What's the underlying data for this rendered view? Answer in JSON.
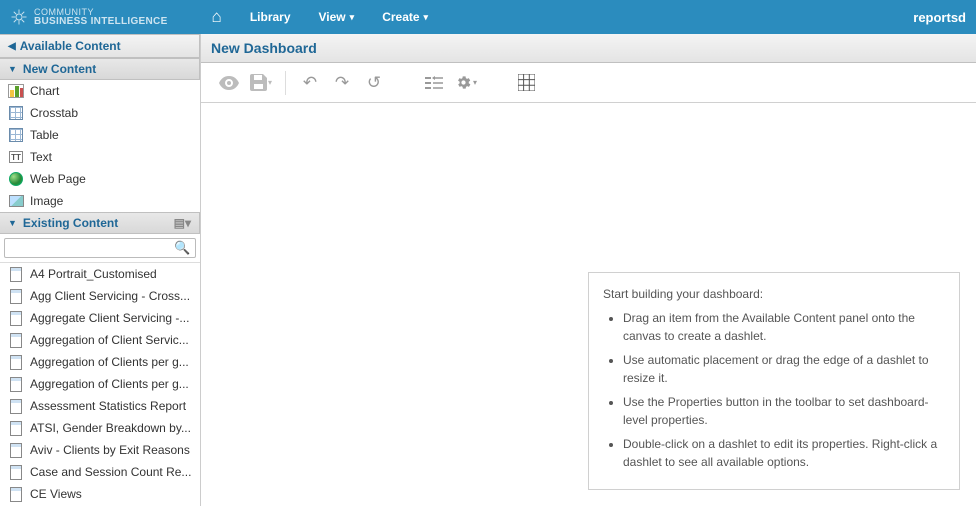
{
  "brand": {
    "line1": "COMMUNITY",
    "line2": "BUSINESS INTELLIGENCE"
  },
  "nav": {
    "home": "",
    "library": "Library",
    "view": "View",
    "create": "Create"
  },
  "user": "reportsd",
  "sidebar": {
    "title": "Available Content",
    "new": {
      "header": "New Content",
      "items": [
        "Chart",
        "Crosstab",
        "Table",
        "Text",
        "Web Page",
        "Image"
      ]
    },
    "existing": {
      "header": "Existing Content",
      "items": [
        "A4 Portrait_Customised",
        "Agg Client Servicing - Cross...",
        "Aggregate Client Servicing -...",
        "Aggregation of Client Servic...",
        "Aggregation of Clients per g...",
        "Aggregation of Clients per g...",
        "Assessment Statistics Report",
        "ATSI, Gender Breakdown by...",
        "Aviv - Clients by Exit Reasons",
        "Case and Session Count Re...",
        "CE Views"
      ]
    }
  },
  "content": {
    "title": "New Dashboard"
  },
  "help": {
    "intro": "Start building your dashboard:",
    "bullets": [
      "Drag an item from the Available Content panel onto the canvas to create a dashlet.",
      "Use automatic placement or drag the edge of a dashlet to resize it.",
      "Use the Properties button in the toolbar to set dashboard-level properties.",
      "Double-click on a dashlet to edit its properties. Right-click a dashlet to see all available options."
    ]
  },
  "icons": {
    "newContent": [
      "chart",
      "grid",
      "grid",
      "txt",
      "globe",
      "img"
    ]
  }
}
